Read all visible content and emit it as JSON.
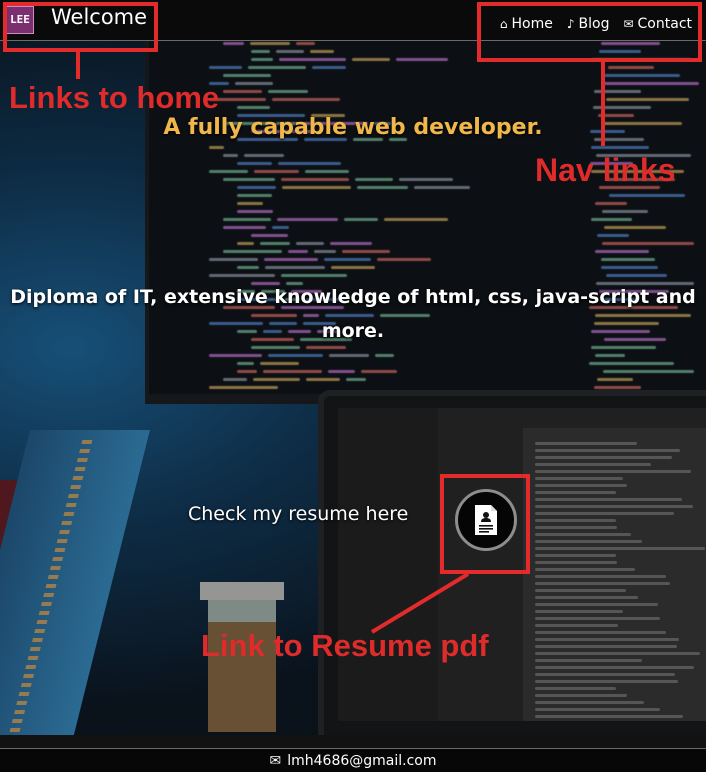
{
  "header": {
    "logo_text": "LEE",
    "title": "Welcome",
    "nav": [
      {
        "icon": "home-icon",
        "glyph": "⌂",
        "label": "Home"
      },
      {
        "icon": "music-note-icon",
        "glyph": "♪",
        "label": "Blog"
      },
      {
        "icon": "envelope-icon",
        "glyph": "✉",
        "label": "Contact"
      }
    ]
  },
  "main": {
    "tagline": "A fully capable web developer.",
    "diploma": "Diploma of IT, extensive knowledge of html, css, java-script and more.",
    "resume_prompt": "Check my resume here"
  },
  "footer": {
    "icon": "envelope-icon",
    "email": "lmh4686@gmail.com"
  },
  "annotations": {
    "home": "Links to home",
    "nav": "Nav links",
    "resume": "Link to Resume pdf",
    "color": "#e32b2b"
  },
  "colors": {
    "tagline": "#f0b84a",
    "header_bg": "#0a0a0a",
    "logo_bg": "#7b2f6f"
  }
}
